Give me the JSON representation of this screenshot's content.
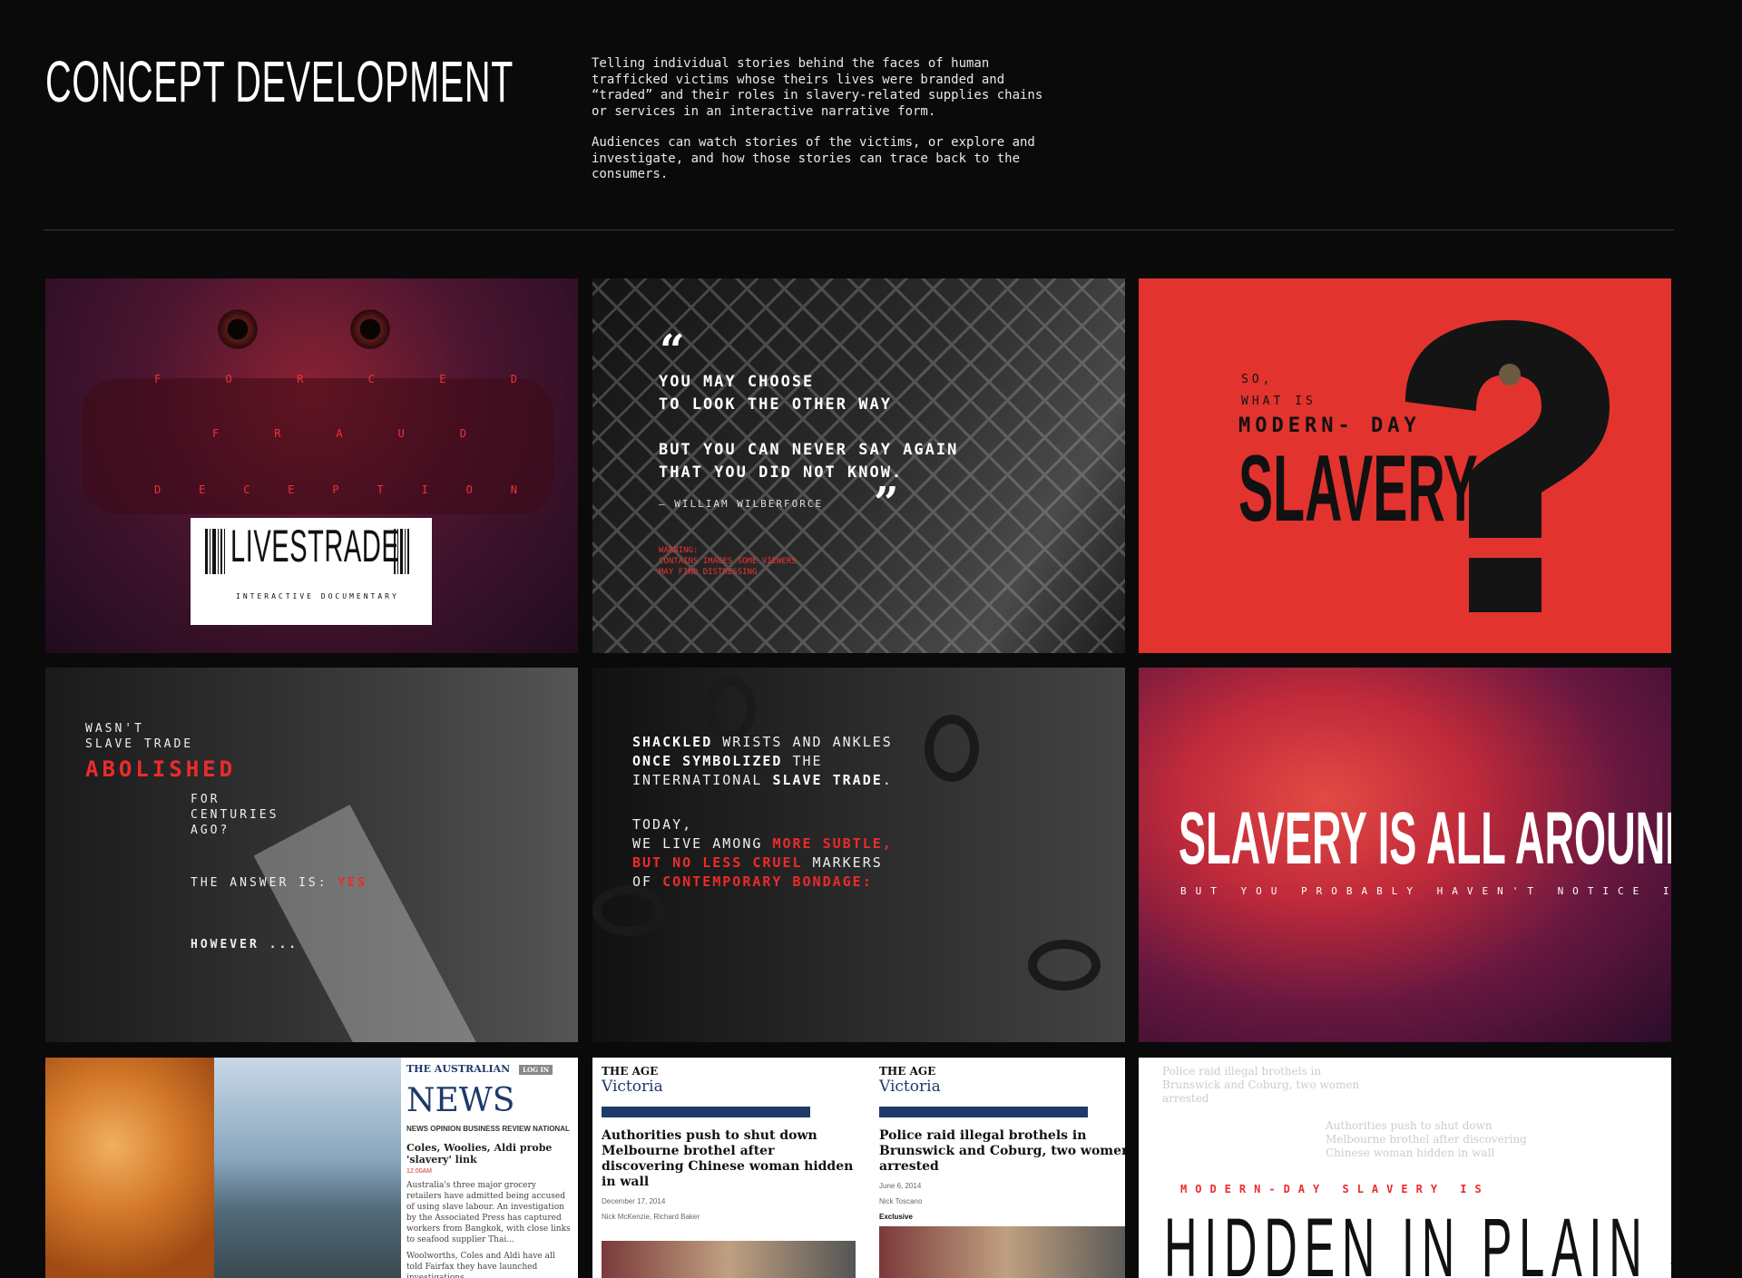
{
  "header": {
    "title": "CONCEPT DEVELOPMENT",
    "intro_p1": "Telling individual stories behind the faces of human trafficked victims whose theirs lives were branded and “traded” and their roles in slavery-related supplies chains or services in an interactive narrative form.",
    "intro_p2": "Audiences can watch stories of the victims, or explore and investigate, and how those stories can trace back to the consumers."
  },
  "panel1": {
    "row1": [
      "F",
      "O",
      "R",
      "C",
      "E",
      "D"
    ],
    "row2": [
      "F",
      "R",
      "A",
      "U",
      "D"
    ],
    "row3": [
      "D",
      "E",
      "C",
      "E",
      "P",
      "T",
      "I",
      "O",
      "N"
    ],
    "brand": "LIVESTRADE",
    "subtitle": "INTERACTIVE DOCUMENTARY"
  },
  "panel2": {
    "open_quote": "“",
    "close_quote": "”",
    "line1": "YOU MAY CHOOSE",
    "line2": "TO LOOK THE OTHER WAY",
    "line3": "BUT YOU CAN NEVER SAY AGAIN",
    "line4": "THAT YOU DID NOT KNOW.",
    "attribution": "– WILLIAM WILBERFORCE",
    "warning_label": "WARNING:",
    "warning_line1": "CONTAINS IMAGES SOME VIEWERS",
    "warning_line2": "MAY FIND DISTRESSING"
  },
  "panel3": {
    "so": "SO,",
    "what_is": "WHAT IS",
    "modern": "MODERN- DAY",
    "slavery": "SLAVERY"
  },
  "panel4": {
    "wasnt": "WASN'T",
    "slave_trade": "SLAVE TRADE",
    "abolished": "ABOLISHED",
    "for": "FOR",
    "centuries": "CENTURIES",
    "ago": "AGO?",
    "answer": "THE ANSWER IS:",
    "yes": "YES",
    "however": "HOWEVER ..."
  },
  "panel5": {
    "shackled": "SHACKLED",
    "wrists": " WRISTS AND ANKLES",
    "once": "ONCE SYMBOLIZED",
    "the": " THE",
    "international": "INTERNATIONAL ",
    "slave_trade": "SLAVE TRADE",
    "dot": ".",
    "today": "TODAY,",
    "we_live": "WE LIVE AMONG ",
    "more_subtle": "MORE SUBTLE,",
    "but_no": "BUT NO LESS CRUEL",
    "markers": " MARKERS",
    "of": "OF ",
    "contemporary": "CONTEMPORARY BONDAGE:"
  },
  "panel6": {
    "headline": "SLAVERY IS ALL AROUND US",
    "sub": "BUT YOU PROBABLY HAVEN'T NOTICE IT"
  },
  "panel7": {
    "masthead": "THE AUSTRALIAN",
    "login": "LOG IN",
    "section": "NEWS",
    "nav": "NEWS  OPINION  BUSINESS REVIEW  NATIONAL",
    "headline": "Coles, Woolies, Aldi probe 'slavery' link",
    "time": "12:00AM",
    "body": "Australia's three major grocery retailers have admitted being accused of using slave labour. An investigation by the Associated Press has captured workers from Bangkok, with close links to seafood supplier Thai...",
    "body2": "Woolworths, Coles and Aldi have all told Fairfax they have launched investigations."
  },
  "panel8": {
    "left": {
      "masthead": "THE AGE",
      "region": "Victoria",
      "headline": "Authorities push to shut down Melbourne brothel after discovering Chinese woman hidden in wall",
      "date": "December 17, 2014",
      "byline": "Nick McKenzie, Richard Baker"
    },
    "right": {
      "masthead": "THE AGE",
      "region": "Victoria",
      "headline": "Police raid illegal brothels in Brunswick and Coburg, two women arrested",
      "date": "June 6, 2014",
      "byline": "Nick Toscano",
      "tag": "Exclusive"
    }
  },
  "panel9": {
    "ghost1": "Police raid illegal brothels in Brunswick and Coburg, two women arrested",
    "ghost2": "Authorities push to shut down Melbourne brothel after discovering Chinese woman hidden in wall",
    "kicker": "MODERN-DAY SLAVERY IS",
    "headline": "HIDDEN IN PLAIN SIGHT"
  }
}
